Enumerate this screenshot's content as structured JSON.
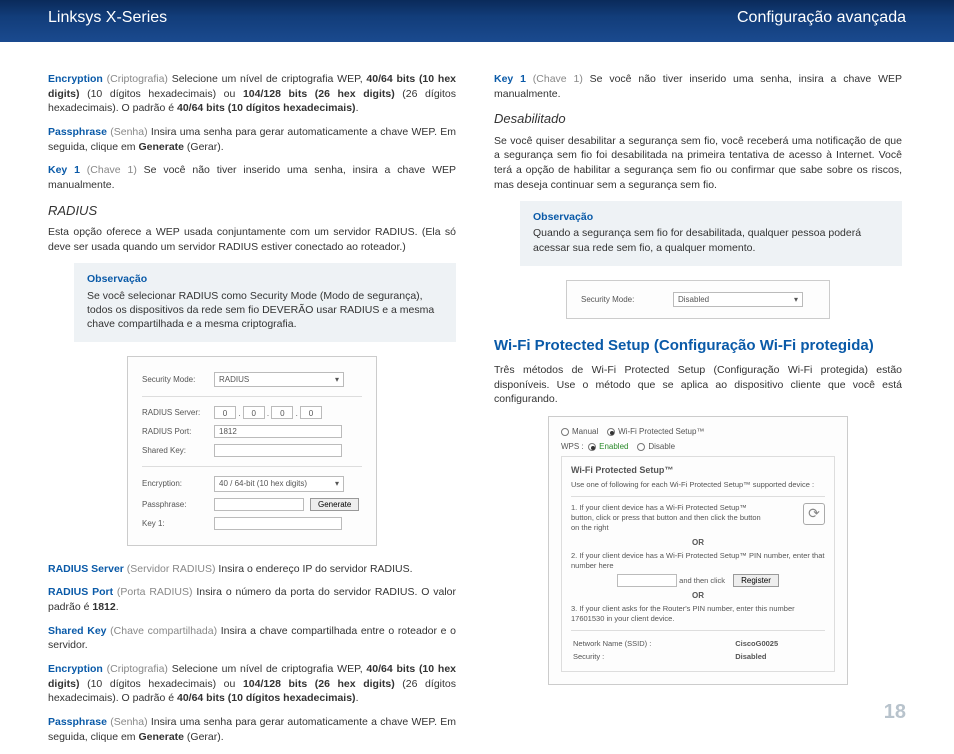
{
  "header": {
    "left": "Linksys X-Series",
    "right": "Configuração avançada"
  },
  "pagenum": "18",
  "left": {
    "encryption_label": "Encryption",
    "encryption_grey": "(Criptografia)",
    "encryption_text1": "  Selecione um nível de criptografia WEP, ",
    "encryption_b1": "40/64 bits (10 hex digits)",
    "encryption_text2": " (10 dígitos hexadecimais) ou ",
    "encryption_b2": "104/128 bits (26 hex digits)",
    "encryption_text3": " (26 dígitos hexadecimais). O padrão é ",
    "encryption_b3": "40/64 bits (10 dígitos hexadecimais)",
    "passphrase_label": "Passphrase",
    "passphrase_grey": "(Senha)",
    "passphrase_text1": " Insira uma senha para gerar automaticamente a chave WEP. Em seguida, clique em ",
    "passphrase_b1": "Generate",
    "passphrase_text2": " (Gerar).",
    "key1_label": "Key 1",
    "key1_grey": "(Chave 1)",
    "key1_text": "  Se você não tiver inserido uma senha, insira a chave WEP manualmente.",
    "radius_h3": "RADIUS",
    "radius_p": "Esta opção oferece a WEP usada conjuntamente com um servidor RADIUS. (Ela só deve ser usada quando um servidor RADIUS estiver conectado ao roteador.)",
    "note1_title": "Observação",
    "note1_body": "Se você selecionar RADIUS como Security Mode (Modo de segurança), todos os dispositivos da rede sem fio DEVERÃO usar RADIUS e a mesma chave compartilhada e a mesma criptografia.",
    "fig_radius": {
      "security_mode_lbl": "Security Mode:",
      "security_mode_val": "RADIUS",
      "radius_server_lbl": "RADIUS Server:",
      "ip": [
        "0",
        "0",
        "0",
        "0"
      ],
      "radius_port_lbl": "RADIUS Port:",
      "radius_port_val": "1812",
      "shared_key_lbl": "Shared Key:",
      "encryption_lbl": "Encryption:",
      "encryption_val": "40 / 64-bit (10 hex digits)",
      "passphrase_lbl": "Passphrase:",
      "generate_btn": "Generate",
      "key1_lbl": "Key 1:"
    },
    "rs_label": "RADIUS Server",
    "rs_grey": "  (Servidor RADIUS)",
    "rs_text": " Insira o endereço IP do servidor RADIUS.",
    "rp_label": "RADIUS Port",
    "rp_grey": "  (Porta RADIUS)",
    "rp_text1": " Insira o número da porta do servidor RADIUS. O valor padrão é ",
    "rp_b1": "1812",
    "sk_label": "Shared Key",
    "sk_grey": " (Chave compartilhada)",
    "sk_text": " Insira a chave compartilhada entre o roteador e o servidor."
  },
  "right": {
    "key1_label": "Key 1",
    "key1_grey": "(Chave 1)",
    "key1_text": "  Se você não tiver inserido uma senha, insira a chave WEP manualmente.",
    "desab_h3": "Desabilitado",
    "desab_p": "Se você quiser desabilitar a segurança sem fio, você receberá uma notificação de que a segurança sem fio foi desabilitada na primeira tentativa de acesso à Internet. Você terá a opção de habilitar a segurança sem fio ou confirmar que sabe sobre os riscos, mas deseja continuar sem a segurança sem fio.",
    "note2_title": "Observação",
    "note2_body": "Quando a segurança sem fio for desabilitada, qualquer pessoa poderá acessar sua rede sem fio, a qualquer momento.",
    "fig_disabled": {
      "security_mode_lbl": "Security Mode:",
      "security_mode_val": "Disabled"
    },
    "wps_h2": "Wi-Fi Protected Setup (Configuração Wi-Fi protegida)",
    "wps_p": "Três métodos de Wi-Fi Protected Setup (Configuração Wi-Fi protegida) estão disponíveis. Use o método que se aplica ao dispositivo cliente que você está configurando.",
    "fig_wps": {
      "manual": "Manual",
      "wps_lbl": "Wi-Fi Protected Setup™",
      "wps_short": "WPS :",
      "enabled": "Enabled",
      "disable": "Disable",
      "title": "Wi-Fi Protected Setup™",
      "sub": "Use one of following for each Wi-Fi Protected Setup™ supported device :",
      "m1": "1. If your client device has a Wi-Fi Protected Setup™ button, click or press that button and then click the button on the right",
      "or": "OR",
      "m2": "2. If your client device has a Wi-Fi Protected Setup™ PIN number, enter that number here",
      "and_then": "and then click",
      "register": "Register",
      "m3": "3. If your client asks for the Router's PIN number, enter this number 17601530 in your client device.",
      "net_name_lbl": "Network Name (SSID) :",
      "net_name_val": "CiscoG0025",
      "sec_lbl": "Security :",
      "sec_val": "Disabled"
    }
  }
}
